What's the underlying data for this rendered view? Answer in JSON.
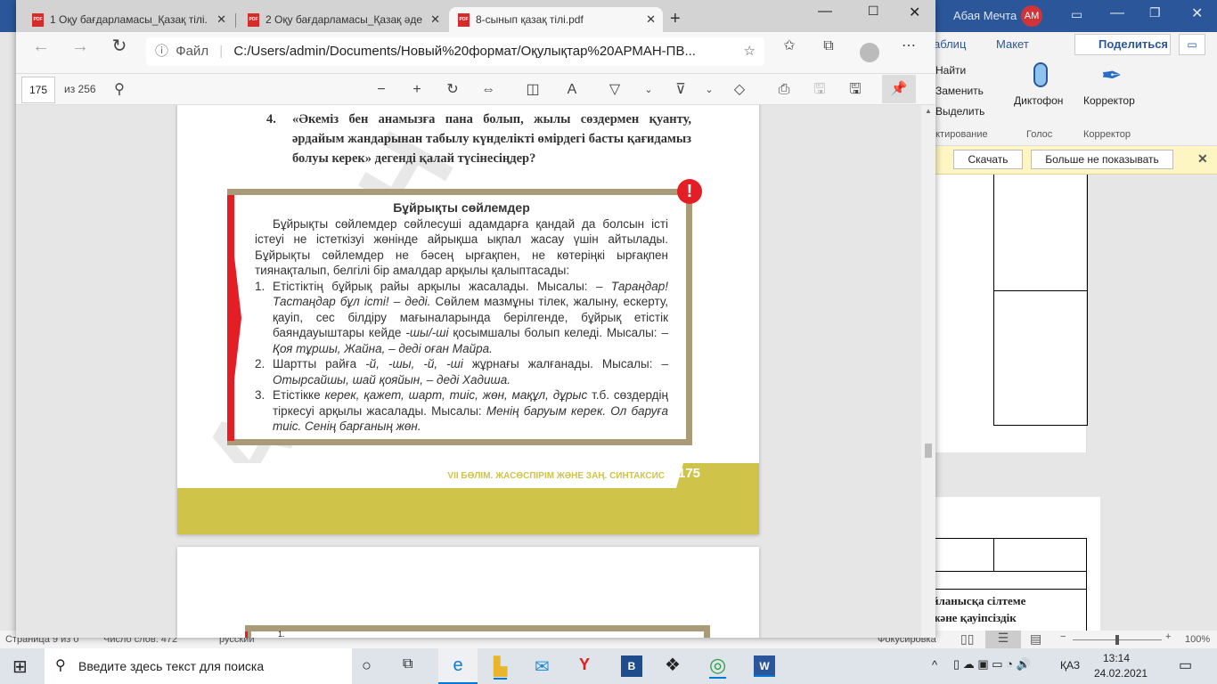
{
  "word": {
    "user": "Абая Мечта",
    "avatar": "АМ",
    "tab_table": "аблиц",
    "tab_layout": "Макет",
    "share": "Поделиться",
    "find": "Найти",
    "replace": "Заменить",
    "select": "Выделить",
    "group_edit": "актирование",
    "dictate": "Диктофон",
    "group_voice": "Голос",
    "editor": "Корректор",
    "group_editor": "Корректор",
    "download": "Скачать",
    "dont_show": "Больше не показывать",
    "doc_line1": "йланысқа сілтеме",
    "doc_line2": "және қауіпсіздік",
    "status_page": "Страница 9 из 0",
    "status_words": "Число слов: 472",
    "status_lang": "русский",
    "focus": "Фокусировка",
    "zoom": "100%",
    "zoom_level": 0.5
  },
  "browser": {
    "tabs": [
      {
        "label": "1 Оқу бағдарламасы_Қазақ тілі."
      },
      {
        "label": "2 Оқу бағдарламасы_Қазақ әде"
      },
      {
        "label": "8-сынып қазақ тілі.pdf"
      }
    ],
    "file_label": "Файл",
    "url": "C:/Users/admin/Documents/Новый%20формат/Оқулықтар%20АРМАН-ПВ...",
    "page_num": "175",
    "page_total": "из 256"
  },
  "pdf": {
    "question_num": "4.",
    "question": "«Әкеміз бен анамызға пана болып, жылы сөздермен қуанту, әрдайым жандарынан табылу күнделікті өмірдегі басты қағидамыз болуы керек» дегенді қалай түсінесіңдер?",
    "box_title": "Бұйрықты сөйлемдер",
    "intro": "Бұйрықты сөйлемдер сөйлесуші адамдарға қандай да болсын істі істеуі не істеткізуі жөнінде айрықша ықпал жасау үшін айтылады. Бұйрықты сөйлемдер не бәсең ырғақпен, не көтеріңкі ырғақпен тиянақталып, белгілі бір амалдар арқылы қалыптасады:",
    "items": [
      {
        "n": "1.",
        "a": "Етістіктің бұйрық райы арқылы жасалады. Мысалы: ",
        "b": "– Тараңдар! Тастаңдар бұл істі! – деді.",
        "c": " Сөйлем мазмұны тілек, жалыну, ескерту, қауіп, сес білдіру мағыналарында берілгенде, бұйрық етістік баяндауыштары кейде ",
        "d": "-шы/-ші",
        "e": " қосымшалы болып келеді. Мысалы: ",
        "f": "– Қоя тұршы, Жайна, – деді оған Майра."
      },
      {
        "n": "2.",
        "a": "Шартты райға ",
        "b": "-й, -шы, -й, -ші",
        "c": " жұрнағы жалғанады. Мысалы: ",
        "d": "– Отырсайшы, шай қояйын, – деді Хадиша."
      },
      {
        "n": "3.",
        "a": "Етістікке ",
        "b": "керек, қажет, шарт, тиіс, жөн, мақұл, дұрыс",
        "c": " т.б. сөздердің тіркесуі арқылы жасалады. Мысалы: ",
        "d": "Менің баруым керек. Ол баруға тиіс. Сенің барғаның жөн."
      }
    ],
    "footer": "VII БӨЛІМ. ЖАСӨСПІРІМ ЖӘНЕ ЗАҢ. СИНТАКСИС",
    "page_number": "175",
    "next_item": "1."
  },
  "taskbar": {
    "search": "Введите здесь текст для поиска",
    "lang": "ҚАЗ",
    "time": "13:14",
    "date": "24.02.2021"
  }
}
